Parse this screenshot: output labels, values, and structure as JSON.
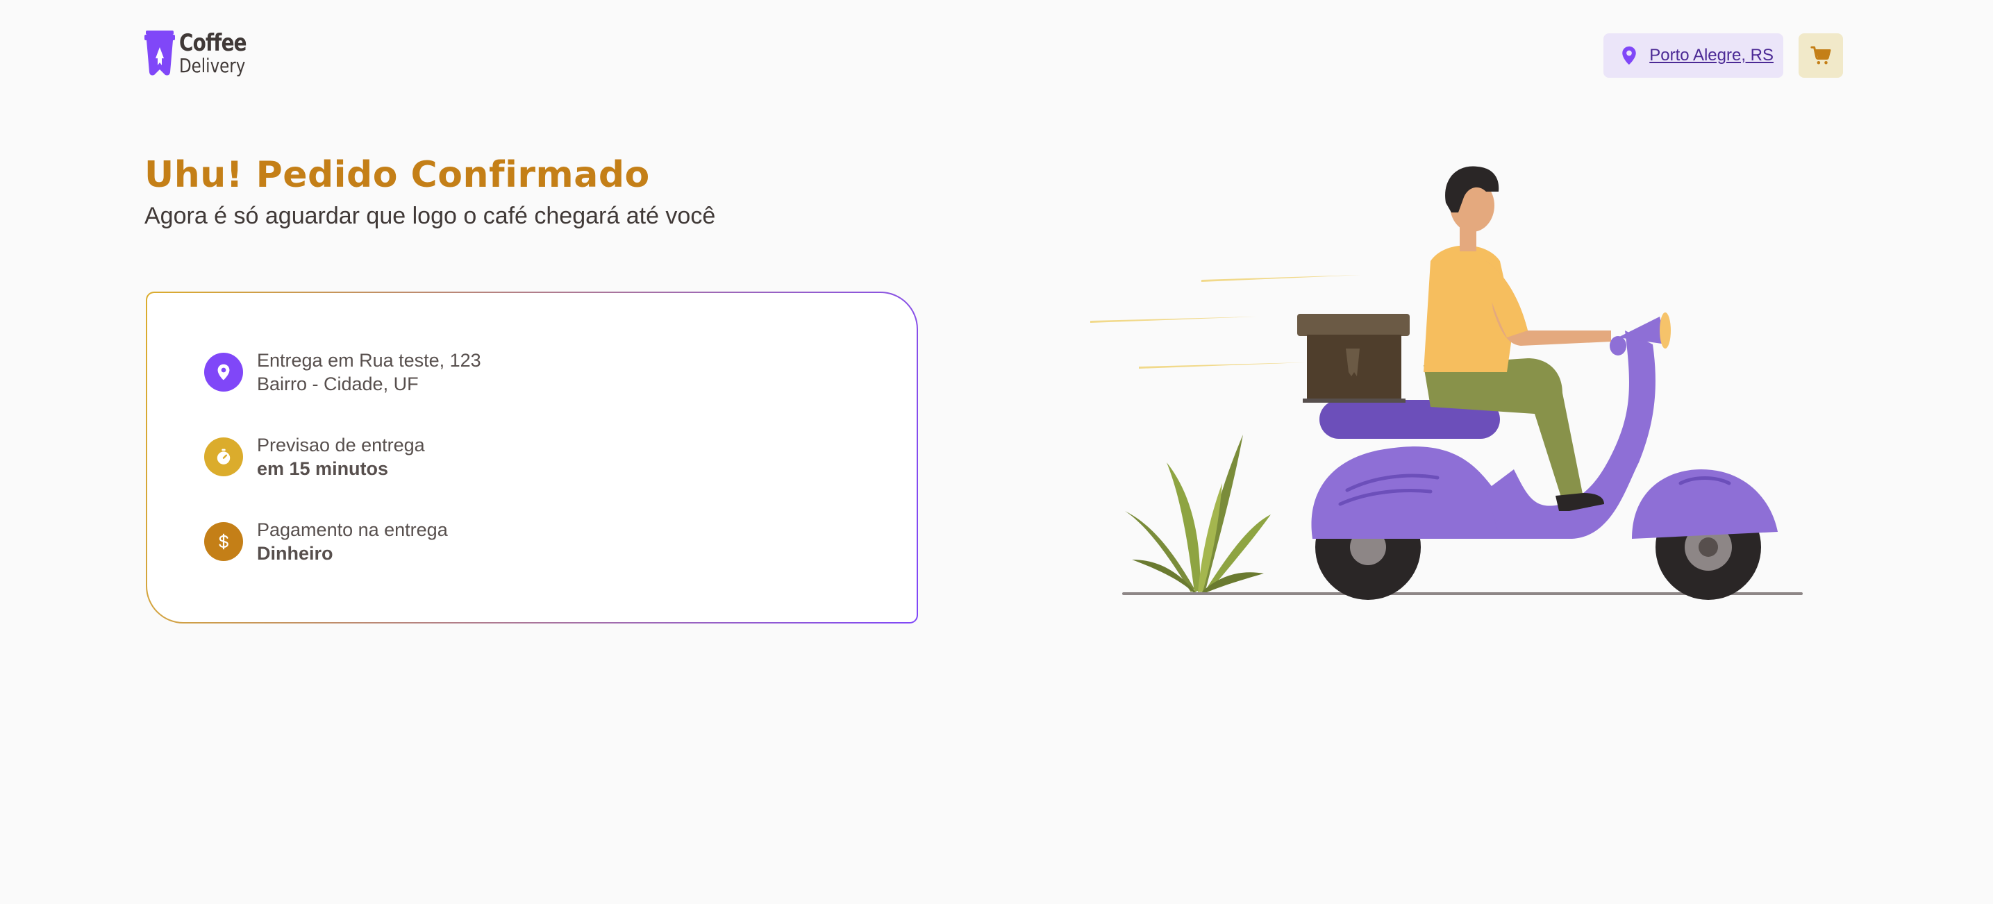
{
  "brand": {
    "name_line1": "Coffee",
    "name_line2": "Delivery",
    "logo_icon": "coffee-cup-rocket-icon",
    "color": "#8047f8"
  },
  "header": {
    "location": "Porto Alegre, RS",
    "location_icon": "map-pin-icon",
    "cart_icon": "shopping-cart-icon"
  },
  "hero": {
    "title": "Uhu! Pedido Confirmado",
    "subtitle": "Agora é só aguardar que logo o café chegará até você"
  },
  "order_info": {
    "address": {
      "icon": "map-pin-icon",
      "color": "#8047f8",
      "line1_prefix": "Entrega em ",
      "street": "Rua teste, 123",
      "line2": "Bairro - Cidade, UF"
    },
    "eta": {
      "icon": "timer-icon",
      "color": "#dbac2c",
      "label": "Previsao de entrega",
      "value": "em 15 minutos"
    },
    "payment": {
      "icon": "currency-dollar-icon",
      "color": "#c47f17",
      "label": "Pagamento na entrega",
      "value": "Dinheiro"
    }
  },
  "illustration": {
    "name": "delivery-man-on-scooter-illustration"
  },
  "colors": {
    "purple": "#8047f8",
    "purple_dark": "#4b2995",
    "purple_light": "#ebe5f9",
    "yellow": "#dbac2c",
    "yellow_dark": "#c47f17",
    "yellow_light": "#f1e9c9",
    "background": "#fafafa"
  }
}
